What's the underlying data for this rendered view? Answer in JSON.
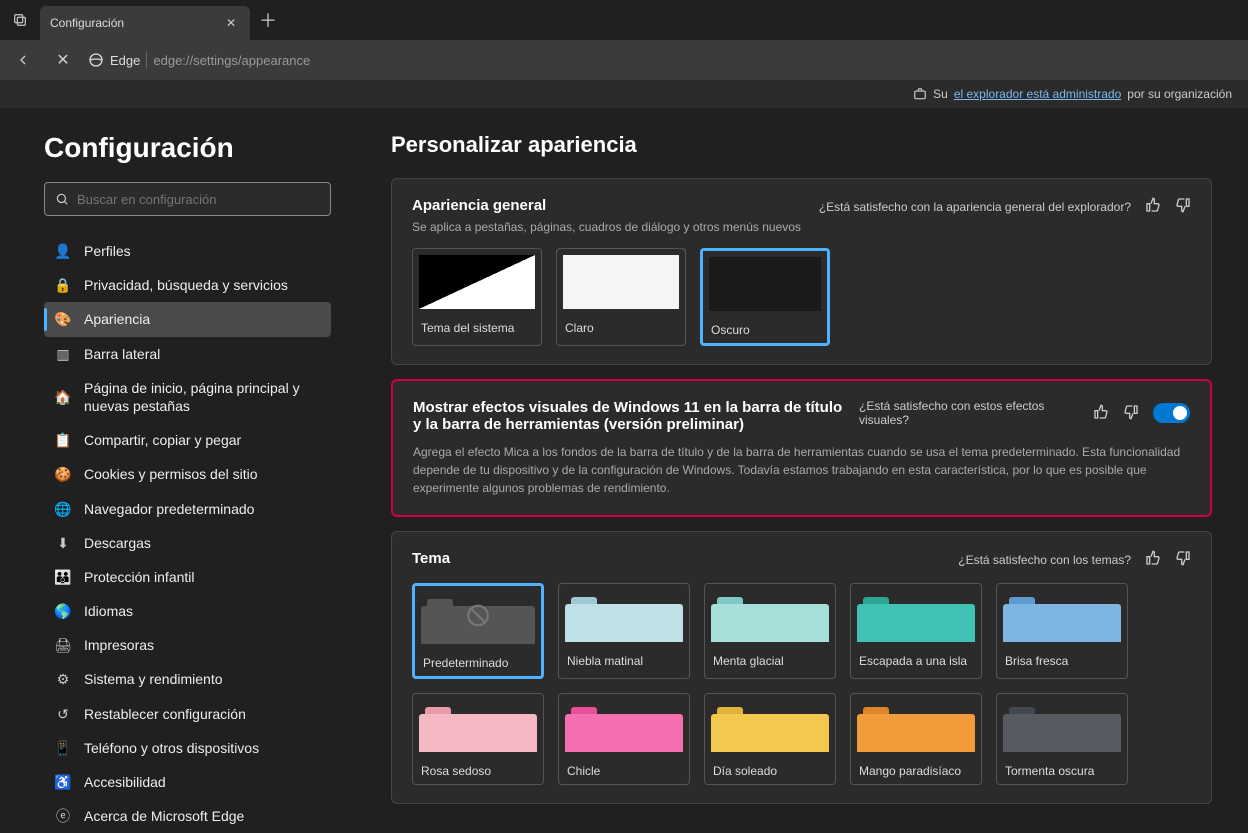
{
  "tab": {
    "title": "Configuración"
  },
  "address": {
    "browser": "Edge",
    "url": "edge://settings/appearance"
  },
  "managed": {
    "prefix": "Su ",
    "link": "el explorador está administrado",
    "suffix": " por su organización"
  },
  "sidebar": {
    "title": "Configuración",
    "search_placeholder": "Buscar en configuración",
    "items": [
      {
        "label": "Perfiles"
      },
      {
        "label": "Privacidad, búsqueda y servicios"
      },
      {
        "label": "Apariencia",
        "active": true
      },
      {
        "label": "Barra lateral"
      },
      {
        "label": "Página de inicio, página principal y nuevas pestañas"
      },
      {
        "label": "Compartir, copiar y pegar"
      },
      {
        "label": "Cookies y permisos del sitio"
      },
      {
        "label": "Navegador predeterminado"
      },
      {
        "label": "Descargas"
      },
      {
        "label": "Protección infantil"
      },
      {
        "label": "Idiomas"
      },
      {
        "label": "Impresoras"
      },
      {
        "label": "Sistema y rendimiento"
      },
      {
        "label": "Restablecer configuración"
      },
      {
        "label": "Teléfono y otros dispositivos"
      },
      {
        "label": "Accesibilidad"
      },
      {
        "label": "Acerca de Microsoft Edge"
      }
    ]
  },
  "main": {
    "title": "Personalizar apariencia",
    "general": {
      "title": "Apariencia general",
      "sub": "Se aplica a pestañas, páginas, cuadros de diálogo y otros menús nuevos",
      "feedback": "¿Está satisfecho con la apariencia general del explorador?",
      "options": [
        {
          "label": "Tema del sistema"
        },
        {
          "label": "Claro"
        },
        {
          "label": "Oscuro",
          "selected": true
        }
      ]
    },
    "effects": {
      "title": "Mostrar efectos visuales de Windows 11 en la barra de título y la barra de herramientas (versión preliminar)",
      "feedback": "¿Está satisfecho con estos efectos visuales?",
      "desc": "Agrega el efecto Mica a los fondos de la barra de título y de la barra de herramientas cuando se usa el tema predeterminado. Esta funcionalidad depende de tu dispositivo y de la configuración de Windows. Todavía estamos trabajando en esta característica, por lo que es posible que experimente algunos problemas de rendimiento.",
      "toggle": true
    },
    "theme": {
      "title": "Tema",
      "feedback": "¿Está satisfecho con los temas?",
      "row1": [
        {
          "label": "Predeterminado",
          "selected": true,
          "body": "#555",
          "tab": "#555",
          "nosign": true
        },
        {
          "label": "Niebla matinal",
          "body": "#bfe0e6",
          "tab": "#9fc9d1"
        },
        {
          "label": "Menta glacial",
          "body": "#a7e0db",
          "tab": "#7fc9c2"
        },
        {
          "label": "Escapada a una isla",
          "body": "#3fc2b3",
          "tab": "#2fa596"
        },
        {
          "label": "Brisa fresca",
          "body": "#7fb5e2",
          "tab": "#5f9bd0"
        }
      ],
      "row2": [
        {
          "label": "Rosa sedoso",
          "body": "#f5b8c2",
          "tab": "#e99aa8"
        },
        {
          "label": "Chicle",
          "body": "#f56fb0",
          "tab": "#e84f98"
        },
        {
          "label": "Día soleado",
          "body": "#f2c94c",
          "tab": "#e0b43a"
        },
        {
          "label": "Mango paradisíaco",
          "body": "#f29b3b",
          "tab": "#e0862a"
        },
        {
          "label": "Tormenta oscura",
          "body": "#555b60",
          "tab": "#42484d"
        }
      ]
    }
  }
}
